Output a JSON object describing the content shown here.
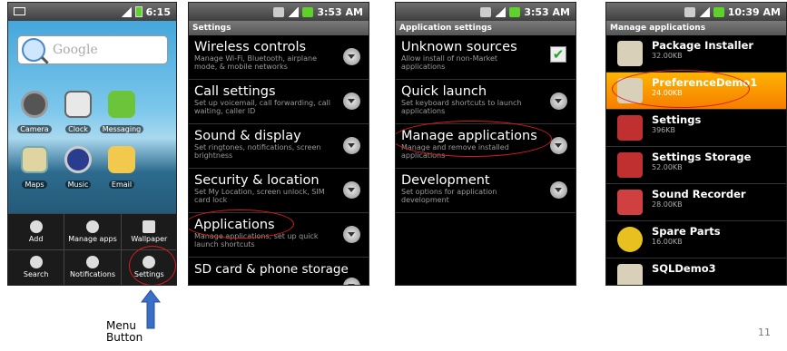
{
  "colors": {
    "accent_red": "#d81c1c",
    "highlight_orange": "#f59a00",
    "arrow_blue": "#3a6fc9"
  },
  "home": {
    "status_time": "6:15",
    "search_placeholder": "Google",
    "apps": [
      {
        "label": "Camera",
        "icon": "camera-icon",
        "color": "#555"
      },
      {
        "label": "Clock",
        "icon": "clock-icon",
        "color": "#e8e8e8"
      },
      {
        "label": "Messaging",
        "icon": "messaging-icon",
        "color": "#6cc43a"
      },
      {
        "label": "Maps",
        "icon": "maps-icon",
        "color": "#e0d4a0"
      },
      {
        "label": "Music",
        "icon": "music-icon",
        "color": "#2a3c8e"
      },
      {
        "label": "Email",
        "icon": "email-icon",
        "color": "#f2c94c"
      }
    ],
    "menu": [
      {
        "label": "Add",
        "icon": "add-icon"
      },
      {
        "label": "Manage apps",
        "icon": "manage-apps-icon"
      },
      {
        "label": "Wallpaper",
        "icon": "wallpaper-icon"
      },
      {
        "label": "Search",
        "icon": "search-icon"
      },
      {
        "label": "Notifications",
        "icon": "notifications-icon"
      },
      {
        "label": "Settings",
        "icon": "settings-icon"
      }
    ]
  },
  "settings": {
    "status_time": "3:53 AM",
    "title": "Settings",
    "items": [
      {
        "title": "Wireless controls",
        "sub": "Manage Wi-Fi, Bluetooth, airplane mode, & mobile networks"
      },
      {
        "title": "Call settings",
        "sub": "Set up voicemail, call forwarding, call waiting, caller ID"
      },
      {
        "title": "Sound & display",
        "sub": "Set ringtones, notifications, screen brightness"
      },
      {
        "title": "Security & location",
        "sub": "Set My Location, screen unlock, SIM card lock"
      },
      {
        "title": "Applications",
        "sub": "Manage applications, set up quick launch shortcuts"
      },
      {
        "title": "SD card & phone storage",
        "sub": ""
      }
    ]
  },
  "app_settings": {
    "status_time": "3:53 AM",
    "title": "Application settings",
    "items": [
      {
        "title": "Unknown sources",
        "sub": "Allow install of non-Market applications"
      },
      {
        "title": "Quick launch",
        "sub": "Set keyboard shortcuts to launch applications"
      },
      {
        "title": "Manage applications",
        "sub": "Manage and remove installed applications"
      },
      {
        "title": "Development",
        "sub": "Set options for application development"
      }
    ]
  },
  "manage_apps": {
    "status_time": "10:39 AM",
    "title": "Manage applications",
    "items": [
      {
        "name": "Package Installer",
        "size": "32.00KB"
      },
      {
        "name": "PreferenceDemo1",
        "size": "24.00KB"
      },
      {
        "name": "Settings",
        "size": "396KB"
      },
      {
        "name": "Settings Storage",
        "size": "52.00KB"
      },
      {
        "name": "Sound Recorder",
        "size": "28.00KB"
      },
      {
        "name": "Spare Parts",
        "size": "16.00KB"
      },
      {
        "name": "SQLDemo3",
        "size": ""
      }
    ]
  },
  "annotation": {
    "line1": "Menu",
    "line2": "Button"
  },
  "page_number": "11"
}
